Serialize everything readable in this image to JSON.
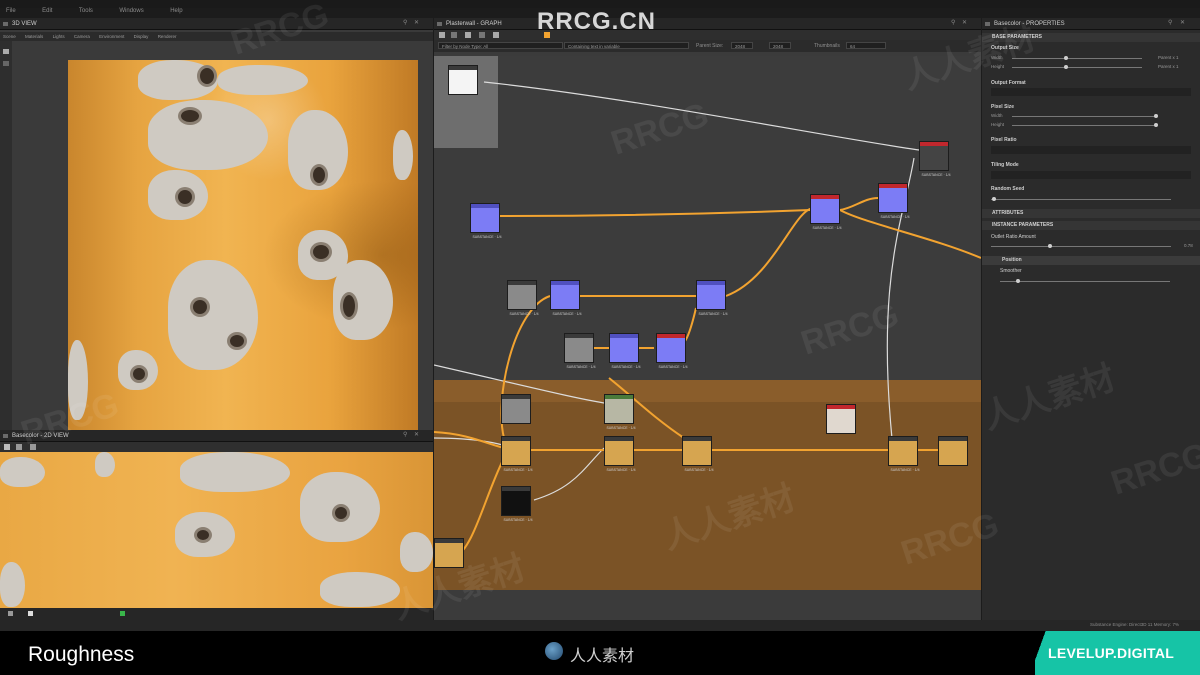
{
  "menubar": {
    "items": [
      "File",
      "Edit",
      "Tools",
      "Windows",
      "Help"
    ]
  },
  "view3d": {
    "title": "3D VIEW",
    "menu": [
      "Scene",
      "Materials",
      "Lights",
      "Camera",
      "Environment",
      "Display",
      "Renderer"
    ]
  },
  "view2d": {
    "title": "Basecolor - 2D VIEW"
  },
  "graph": {
    "title": "Plasterwall - GRAPH",
    "filter": "Filter by Node Type: All",
    "filter2": "Containing text in variable",
    "parent_size_label": "Parent Size:",
    "parent_size_value": "2048",
    "size2": "2048",
    "thumb_label": "Thumbnails",
    "thumb_value": "64",
    "node_label": "SUBSTANCE · 1/4"
  },
  "props": {
    "title": "Basecolor - PROPERTIES",
    "base_params": "BASE PARAMETERS",
    "output_size": "Output Size",
    "width": "Width",
    "height": "Height",
    "parent_x1": "Parent x 1",
    "output_format": "Output Format",
    "pixel_size": "Pixel Size",
    "pixel_ratio": "Pixel Ratio",
    "tiling_mode": "Tiling Mode",
    "random_seed": "Random Seed",
    "attributes": "ATTRIBUTES",
    "instance_params": "INSTANCE PARAMETERS",
    "outlet": "Outlet Ratio Amount",
    "outlet_val": "0.78",
    "position": "Position",
    "smoother": "Smoother"
  },
  "statusbar": {
    "text": "Substance Engine: Direct3D 11  Memory: 7%"
  },
  "caption": {
    "text": "Roughness"
  },
  "site_logo": "人人素材",
  "brand": "LEVELUP.DIGITAL",
  "watermark_top": "RRCG.CN",
  "watermarks": [
    "RRCG",
    "人人素材"
  ],
  "colors": {
    "accent_teal": "#16c4a6",
    "wire": "#f2a330",
    "node_blue": "#7c7cf5",
    "node_red": "#c1272d"
  }
}
